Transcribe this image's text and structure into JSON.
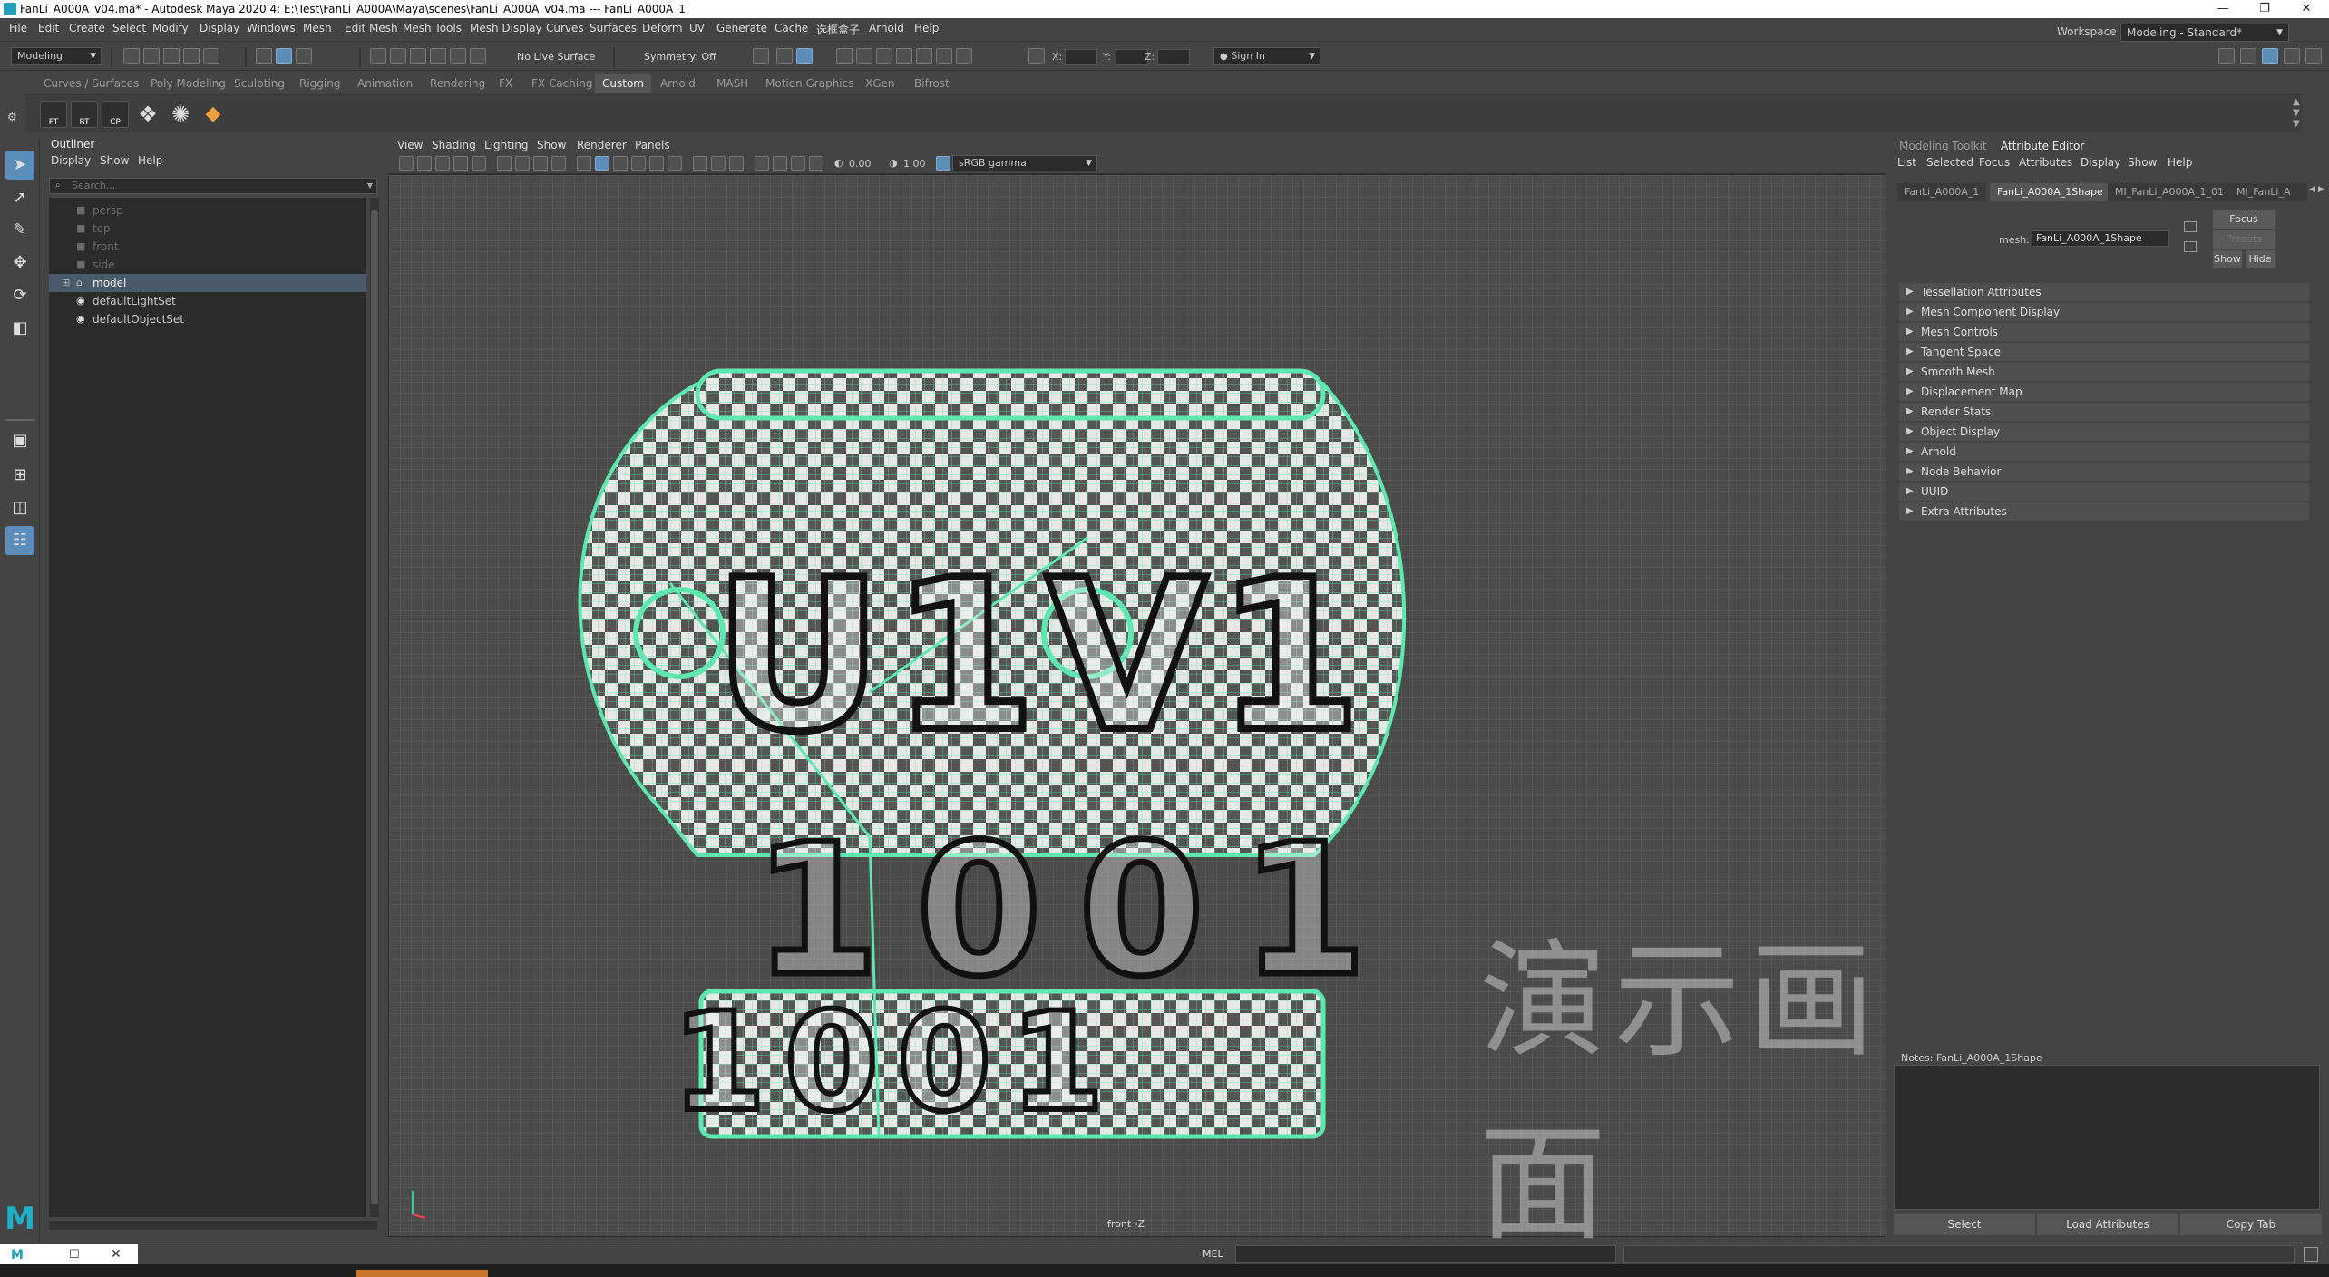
{
  "window": {
    "title": "FanLi_A000A_v04.ma* - Autodesk Maya 2020.4: E:\\Test\\FanLi_A000A\\Maya\\scenes\\FanLi_A000A_v04.ma  ---  FanLi_A000A_1",
    "minimize": "—",
    "restore": "❐",
    "close": "✕"
  },
  "menubar": {
    "items": [
      "File",
      "Edit",
      "Create",
      "Select",
      "Modify",
      "Display",
      "Windows",
      "Mesh",
      "Edit Mesh",
      "Mesh Tools",
      "Mesh Display",
      "Curves",
      "Surfaces",
      "Deform",
      "UV",
      "Generate",
      "Cache",
      "选框盒子",
      "Arnold",
      "Help"
    ],
    "workspace_label": "Workspace :",
    "workspace_value": "Modeling - Standard*"
  },
  "statusline": {
    "mode": "Modeling",
    "live_surface": "No Live Surface",
    "symmetry": "Symmetry: Off",
    "x_label": "X:",
    "y_label": "Y:",
    "z_label": "Z:",
    "sign_in": "Sign In"
  },
  "shelf": {
    "tabs": [
      "Curves / Surfaces",
      "Poly Modeling",
      "Sculpting",
      "Rigging",
      "Animation",
      "Rendering",
      "FX",
      "FX Caching",
      "Custom",
      "Arnold",
      "MASH",
      "Motion Graphics",
      "XGen",
      "Bifrost"
    ],
    "active_tab": "Custom",
    "buttons": [
      "FT",
      "RT",
      "CP"
    ]
  },
  "outliner": {
    "title": "Outliner",
    "menu": [
      "Display",
      "Show",
      "Help"
    ],
    "search_placeholder": "Search...",
    "items": [
      {
        "label": "persp",
        "dim": true
      },
      {
        "label": "top",
        "dim": true
      },
      {
        "label": "front",
        "dim": true
      },
      {
        "label": "side",
        "dim": true
      },
      {
        "label": "model",
        "dim": false,
        "selected": true
      },
      {
        "label": "defaultLightSet",
        "dim": false
      },
      {
        "label": "defaultObjectSet",
        "dim": false
      }
    ]
  },
  "viewport": {
    "menu": [
      "View",
      "Shading",
      "Lighting",
      "Show",
      "Renderer",
      "Panels"
    ],
    "exposure": "0.00",
    "gamma": "1.00",
    "color_space": "sRGB gamma",
    "camera_label": "front -Z",
    "watermark": "演示画面",
    "model_text_top": "U1V1",
    "model_text_mid": "1001",
    "model_text_base": "1001",
    "wire_color": "#5ee8b0"
  },
  "attribute_editor": {
    "tabs": [
      "Modeling Toolkit",
      "Attribute Editor"
    ],
    "active_tab": "Attribute Editor",
    "menu": [
      "List",
      "Selected",
      "Focus",
      "Attributes",
      "Display",
      "Show",
      "Help"
    ],
    "node_tabs": [
      "FanLi_A000A_1",
      "FanLi_A000A_1Shape",
      "MI_FanLi_A000A_1_01",
      "MI_FanLi_A"
    ],
    "active_node_tab": "FanLi_A000A_1Shape",
    "mesh_label": "mesh:",
    "mesh_value": "FanLi_A000A_1Shape",
    "focus_btn": "Focus",
    "presets_btn": "Presets",
    "show_btn": "Show",
    "hide_btn": "Hide",
    "sections": [
      "Tessellation Attributes",
      "Mesh Component Display",
      "Mesh Controls",
      "Tangent Space",
      "Smooth Mesh",
      "Displacement Map",
      "Render Stats",
      "Object Display",
      "Arnold",
      "Node Behavior",
      "UUID",
      "Extra Attributes"
    ],
    "notes_label": "Notes:  FanLi_A000A_1Shape",
    "bottom_buttons": [
      "Select",
      "Load Attributes",
      "Copy Tab"
    ]
  },
  "commandline": {
    "label": "MEL"
  }
}
